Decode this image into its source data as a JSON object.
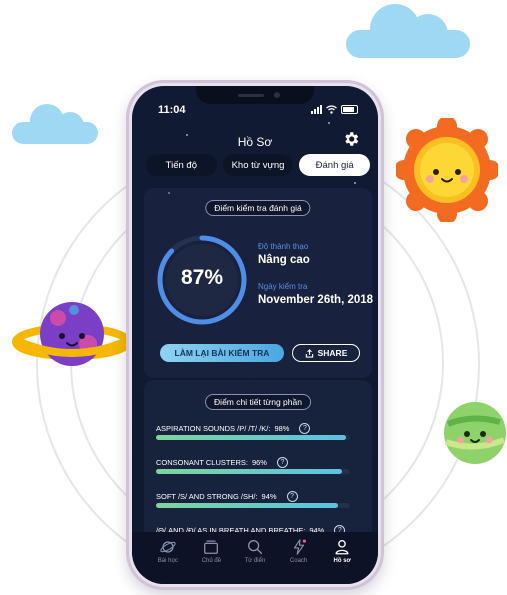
{
  "status_bar": {
    "time": "11:04"
  },
  "header": {
    "title": "Hồ Sơ"
  },
  "tabs": [
    {
      "label": "Tiến độ",
      "active": false
    },
    {
      "label": "Kho từ vựng",
      "active": false
    },
    {
      "label": "Đánh giá",
      "active": true
    }
  ],
  "assessment": {
    "section_title": "Điểm kiểm tra đánh giá",
    "score_percent": 87,
    "score_label": "87%",
    "level_label": "Độ thành thạo",
    "level_value": "Nâng cao",
    "date_label": "Ngày kiểm tra",
    "date_value": "November 26th, 2018",
    "retake_button": "LÀM LẠI BÀI KIỂM TRA",
    "share_button": "SHARE"
  },
  "details": {
    "section_title": "Điểm chi tiết từng phần",
    "items": [
      {
        "label": "ASPIRATION SOUNDS /P/ /T/ /K/:",
        "score": "98%",
        "fraction": 0.98
      },
      {
        "label": "CONSONANT CLUSTERS:",
        "score": "96%",
        "fraction": 0.96
      },
      {
        "label": "SOFT /S/ AND STRONG /SH/:",
        "score": "94%",
        "fraction": 0.94
      },
      {
        "label": "/Θ/ AND /Đ/ AS IN BREATH AND BREATHE:",
        "score": "94%",
        "fraction": 0.94
      }
    ]
  },
  "bottom_nav": [
    {
      "label": "Bài học",
      "icon": "planet-icon",
      "active": false
    },
    {
      "label": "Chủ đề",
      "icon": "stack-icon",
      "active": false
    },
    {
      "label": "Từ điển",
      "icon": "search-icon",
      "active": false
    },
    {
      "label": "Coach",
      "icon": "lightning-icon",
      "active": false
    },
    {
      "label": "Hồ sơ",
      "icon": "user-icon",
      "active": true
    }
  ],
  "colors": {
    "accent_blue": "#4aa7e0",
    "progress_green": "#7fd49d",
    "ring_blue": "#4f8de6",
    "background_dark": "#101a33"
  }
}
